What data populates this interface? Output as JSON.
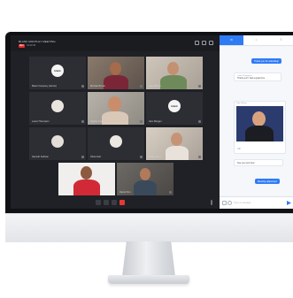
{
  "meeting": {
    "title": "BLANK MONTHLY MEETING",
    "rec_label": "REC",
    "elapsed": "01:23:45"
  },
  "participants": [
    {
      "name": "Blank Company (Admin)",
      "kind": "logo",
      "logo_text": "blank"
    },
    {
      "name": "Michael Brown",
      "kind": "video"
    },
    {
      "name": "Jake Wilson",
      "kind": "video"
    },
    {
      "name": "Laura Thompson",
      "kind": "avatar"
    },
    {
      "name": "Sophie Grant",
      "kind": "video"
    },
    {
      "name": "Alex Morgan",
      "kind": "logo",
      "logo_text": "blank"
    },
    {
      "name": "Hannah Sullivan",
      "kind": "avatar"
    },
    {
      "name": "Olivia Hart",
      "kind": "avatar"
    },
    {
      "name": "Emily Carter",
      "kind": "video"
    },
    {
      "name": "",
      "kind": "video"
    },
    {
      "name": "Daniel Kim",
      "kind": "video"
    }
  ],
  "chat": {
    "tabs": [
      "chat-icon",
      "people-icon",
      "files-icon"
    ],
    "messages": [
      {
        "type": "out",
        "text": "Thank you for attending!"
      },
      {
        "type": "in",
        "sender": "Laura Thompson",
        "text": "Thank you! I had a great time"
      },
      {
        "type": "in",
        "sender": "Jake Wilson",
        "text": "GIF"
      },
      {
        "type": "in",
        "sender": "",
        "text": "See you next time!"
      },
      {
        "type": "out",
        "text": "Meeting adjourned."
      }
    ],
    "input_placeholder": "Type a message..."
  },
  "colors": {
    "accent": "#2f7bf6",
    "end_call": "#e53935",
    "rec": "#e02b2b"
  }
}
